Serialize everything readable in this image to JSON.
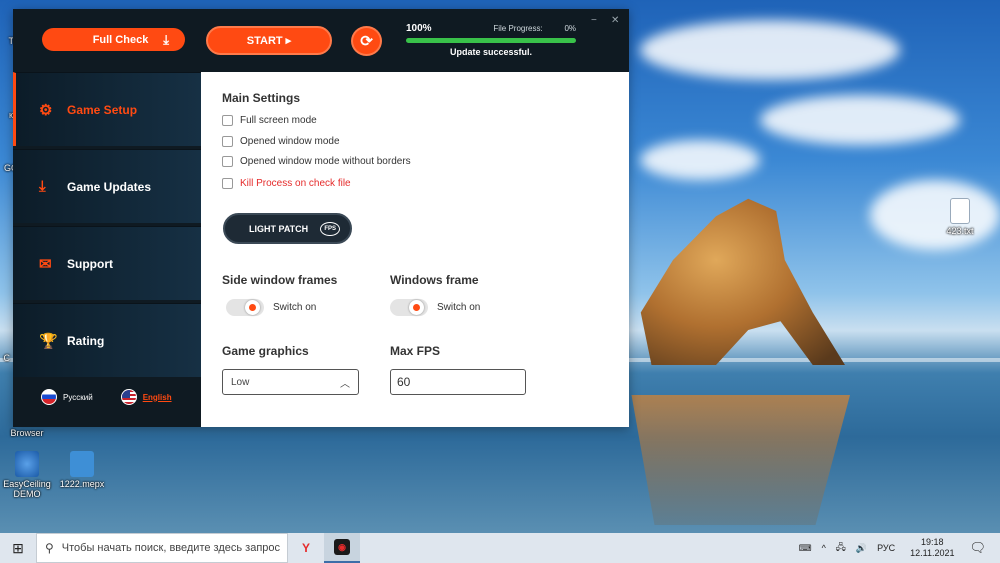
{
  "topbar": {
    "full_check_label": "Full Check",
    "start_label": "START ▸",
    "progress_percent": "100%",
    "progress_value": 1.0,
    "file_progress_label": "File Progress:",
    "file_progress_value": "0%",
    "status": "Update successful.",
    "minimize_glyph": "−",
    "close_glyph": "✕"
  },
  "sidebar": {
    "items": [
      {
        "label": "Game Setup",
        "icon": "gear-icon",
        "glyph": "⚙"
      },
      {
        "label": "Game Updates",
        "icon": "download-icon",
        "glyph": "⤓"
      },
      {
        "label": "Support",
        "icon": "chat-icon",
        "glyph": "✉"
      },
      {
        "label": "Rating",
        "icon": "trophy-icon",
        "glyph": "🏆"
      }
    ],
    "lang_ru": "Русский",
    "lang_en": "English"
  },
  "main": {
    "settings_title": "Main Settings",
    "options": [
      {
        "label": "Full screen mode",
        "checked": false
      },
      {
        "label": "Opened window mode",
        "checked": false
      },
      {
        "label": "Opened window mode without borders",
        "checked": false
      },
      {
        "label": "Kill Process on check file",
        "checked": false
      }
    ],
    "light_patch_label": "LIGHT PATCH",
    "fps_badge": "FPS",
    "side_frames_title": "Side window frames",
    "side_frames_toggle": "Switch on",
    "windows_frame_title": "Windows frame",
    "windows_frame_toggle": "Switch on",
    "graphics_title": "Game graphics",
    "graphics_value": "Low",
    "maxfps_title": "Max FPS",
    "maxfps_value": "60"
  },
  "desktop": {
    "icons": [
      {
        "label": "Browser"
      },
      {
        "label": "EasyCeiling DEMO"
      },
      {
        "label": "1222.mepx"
      },
      {
        "label": "423.txt"
      }
    ],
    "edge_fragments": [
      "To",
      "ко",
      "GG",
      "C"
    ]
  },
  "taskbar": {
    "search_placeholder": "Чтобы начать поиск, введите здесь запрос",
    "yandex_glyph": "Y",
    "lang": "РУС",
    "time": "19:18",
    "date": "12.11.2021"
  },
  "colors": {
    "accent": "#ff4a12",
    "dark_bg": "#0f1a22",
    "progress_green": "#39c24a",
    "warning_red": "#e52b2b"
  }
}
